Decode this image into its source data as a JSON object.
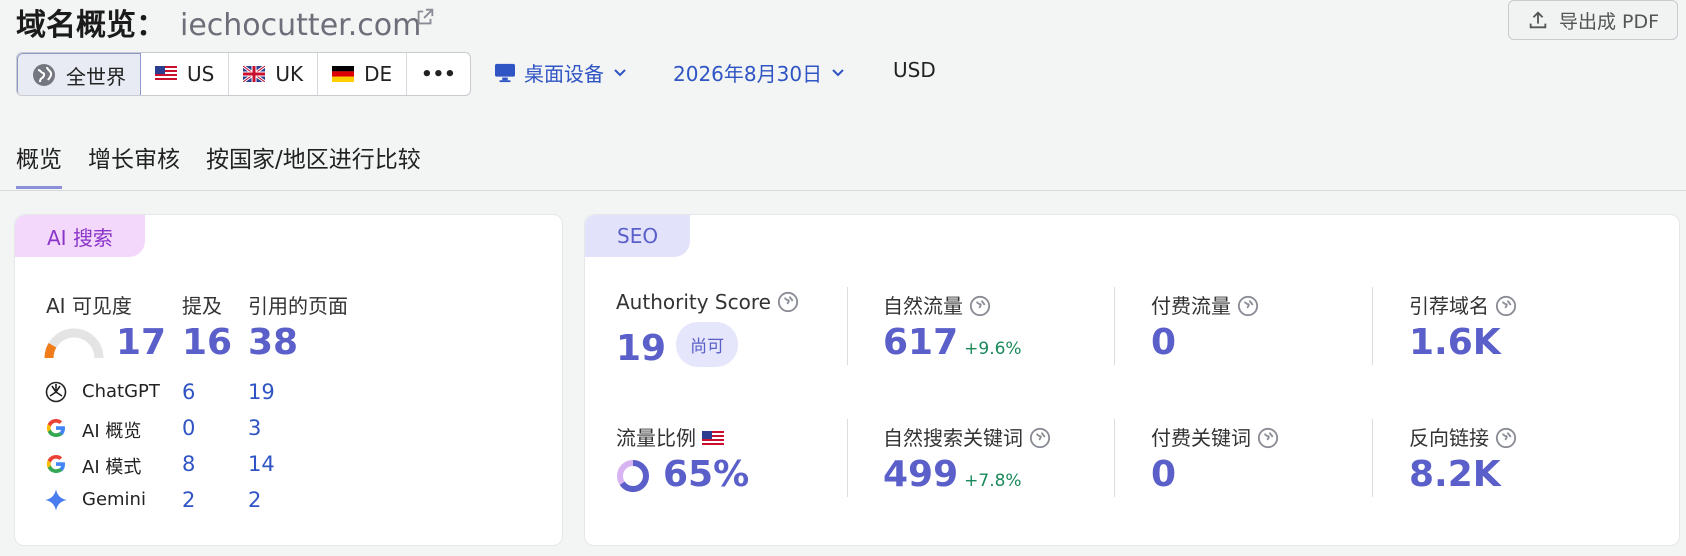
{
  "header": {
    "title_prefix": "域名概览：",
    "domain": "iechocutter.com",
    "export_label": "导出成 PDF"
  },
  "regions": [
    {
      "label": "全世界",
      "icon": "globe-icon",
      "active": true
    },
    {
      "label": "US",
      "icon": "flag-us-icon"
    },
    {
      "label": "UK",
      "icon": "flag-uk-icon"
    },
    {
      "label": "DE",
      "icon": "flag-de-icon"
    },
    {
      "label": "•••",
      "icon": "more-icon"
    }
  ],
  "filters": {
    "device": "桌面设备",
    "date": "2026年8月30日",
    "currency": "USD"
  },
  "tabs": [
    "概览",
    "增长审核",
    "按国家/地区进行比较"
  ],
  "ai": {
    "tag": "AI 搜索",
    "headers": [
      "AI 可见度",
      "提及",
      "引用的页面"
    ],
    "visibility": "17",
    "mentions": "16",
    "cited_pages": "38",
    "gauge_fraction": 0.17,
    "rows": [
      {
        "name": "ChatGPT",
        "icon": "chatgpt-icon",
        "mentions": "6",
        "pages": "19"
      },
      {
        "name": "AI 概览",
        "icon": "google-icon",
        "mentions": "0",
        "pages": "3"
      },
      {
        "name": "AI 模式",
        "icon": "google-icon",
        "mentions": "8",
        "pages": "14"
      },
      {
        "name": "Gemini",
        "icon": "gemini-icon",
        "mentions": "2",
        "pages": "2"
      }
    ]
  },
  "seo": {
    "tag": "SEO",
    "authority_label": "Authority Score",
    "authority_value": "19",
    "authority_badge": "尚可",
    "organic_traffic_label": "自然流量",
    "organic_traffic_value": "617",
    "organic_traffic_change": "+9.6%",
    "paid_traffic_label": "付费流量",
    "paid_traffic_value": "0",
    "ref_domains_label": "引荐域名",
    "ref_domains_value": "1.6K",
    "traffic_share_label": "流量比例",
    "traffic_share_value": "65%",
    "traffic_share_fraction": 0.65,
    "organic_kw_label": "自然搜索关键词",
    "organic_kw_value": "499",
    "organic_kw_change": "+7.8%",
    "paid_kw_label": "付费关键词",
    "paid_kw_value": "0",
    "backlinks_label": "反向链接",
    "backlinks_value": "8.2K"
  },
  "colors": {
    "accent": "#5a5fc9",
    "link": "#2f54c4",
    "positive": "#1a8a5a",
    "gauge_fill": "#f07d1a"
  }
}
